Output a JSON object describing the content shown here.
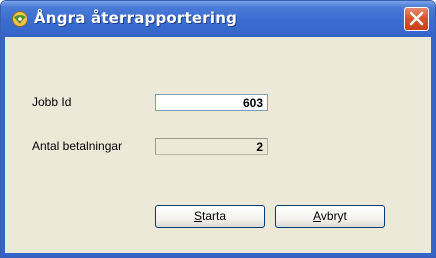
{
  "window": {
    "title": "Ångra återrapportering",
    "app_icon": "gear-globe-icon",
    "close_icon": "close-icon",
    "title_color": "#3464c8",
    "close_color": "#d9542b"
  },
  "form": {
    "job_id_label": "Jobb Id",
    "job_id_value": "603",
    "payments_label": "Antal betalningar",
    "payments_value": "2"
  },
  "buttons": {
    "start_accel": "S",
    "start_rest": "tarta",
    "cancel_accel": "A",
    "cancel_rest": "vbryt"
  }
}
